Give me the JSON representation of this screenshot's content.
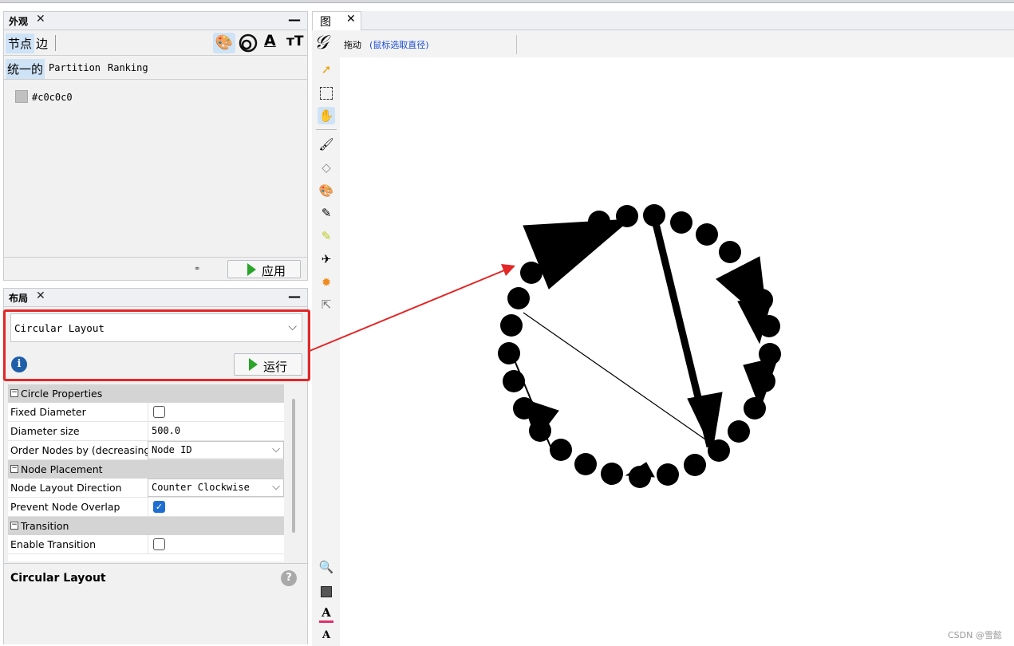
{
  "appearance": {
    "tab_title": "外观",
    "sub_tabs": [
      "节点",
      "边"
    ],
    "mode_tabs": [
      "统一的",
      "Partition",
      "Ranking"
    ],
    "color_value": "#c0c0c0",
    "apply_label": "应用"
  },
  "layout": {
    "tab_title": "布局",
    "selected_layout": "Circular Layout",
    "run_label": "运行",
    "properties": {
      "section_circle": "Circle Properties",
      "fixed_diameter": "Fixed Diameter",
      "diameter_size": "Diameter size",
      "diameter_value": "500.0",
      "order_nodes": "Order Nodes by (decreasing)",
      "order_value": "Node ID",
      "section_placement": "Node Placement",
      "direction_label": "Node Layout Direction",
      "direction_value": "Counter Clockwise",
      "overlap_label": "Prevent Node Overlap",
      "section_transition": "Transition",
      "enable_transition": "Enable Transition"
    },
    "description_title": "Circular Layout"
  },
  "graph": {
    "tab_title": "图",
    "mode_label": "拖动",
    "mode_hint": "(鼠标选取直径)"
  },
  "watermark": "CSDN @雪懿"
}
